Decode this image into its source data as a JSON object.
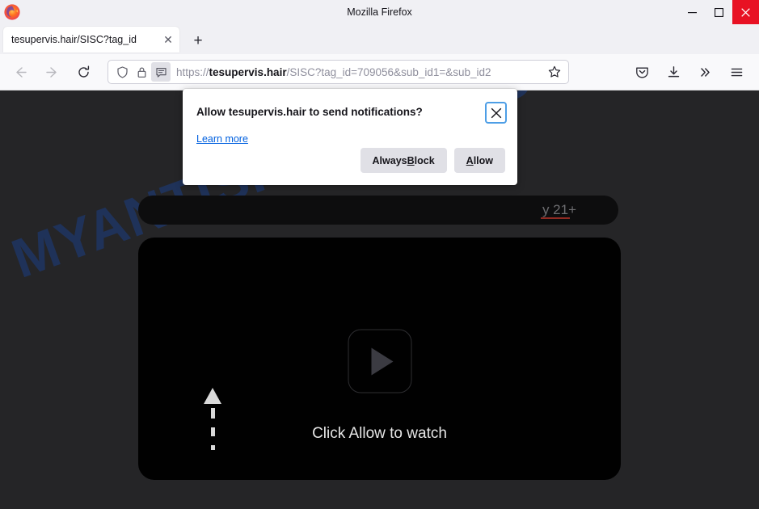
{
  "window": {
    "title": "Mozilla Firefox",
    "controls": {
      "minimize": "minimize",
      "maximize": "maximize",
      "close": "close"
    }
  },
  "tabs": {
    "items": [
      {
        "label": "tesupervis.hair/SISC?tag_id",
        "close_label": "✕"
      }
    ],
    "new_tab_label": "+"
  },
  "toolbar": {
    "back": "←",
    "forward": "→",
    "reload": "reload",
    "url_prefix": "https://",
    "url_host": "tesupervis.hair",
    "url_path": "/SISC?tag_id=709056&sub_id1=&sub_id2",
    "bookmark": "bookmark-star",
    "pocket": "pocket",
    "downloads": "downloads",
    "overflow": "»",
    "menu": "menu"
  },
  "dialog": {
    "title": "Allow tesupervis.hair to send notifications?",
    "learn_more": "Learn more",
    "close": "✕",
    "buttons": {
      "block_pre": "Always ",
      "block_key": "B",
      "block_post": "lock",
      "allow_key": "A",
      "allow_post": "llow"
    }
  },
  "page": {
    "watermark": "MYANTISPYWARE.COM",
    "banner_text": "y 21+",
    "player_caption": "Click Allow to watch",
    "background_color": "#252527",
    "player_color": "#010101",
    "watermark_color": "#1c3a78",
    "accent_color": "#0060df"
  }
}
